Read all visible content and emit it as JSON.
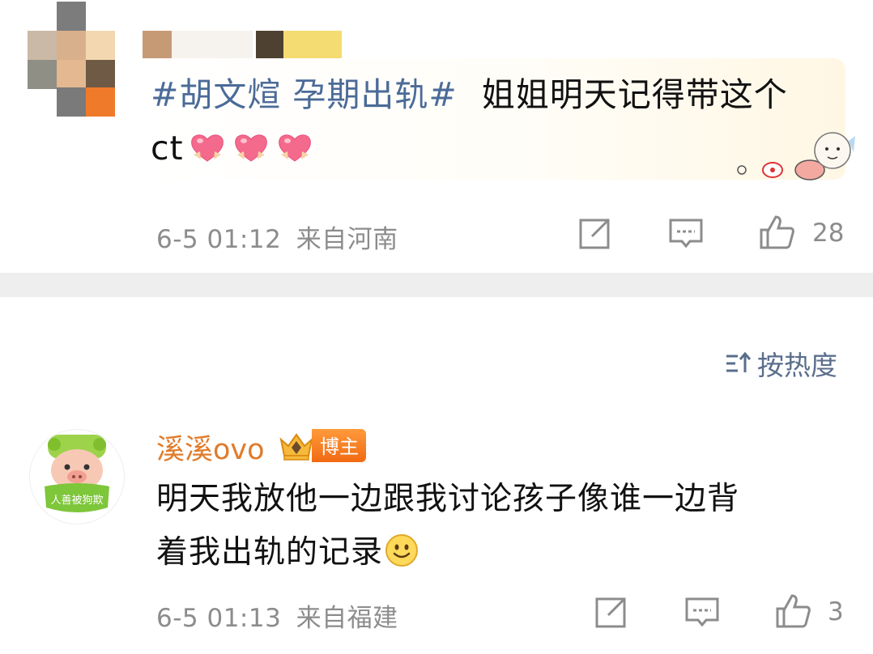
{
  "top_post": {
    "hashtag": "#胡文煊 孕期出轨#",
    "text": "姐姐明天记得带这个",
    "text_line2": "ct",
    "emoji_icons": [
      "pink-heart-emoji",
      "pink-heart-emoji",
      "pink-heart-emoji"
    ],
    "timestamp": "6-5 01:12",
    "location": "来自河南",
    "like_count": "28"
  },
  "sort": {
    "label": "按热度",
    "icon": "sort-icon"
  },
  "comment": {
    "username": "溪溪ovo",
    "badge_label": "博主",
    "avatar_text": "人善被狗欺",
    "text_line1": "明天我放他一边跟我讨论孩子像谁一边背",
    "text_line2": "着我出轨的记录",
    "emoji_icon": "smiley-emoji",
    "timestamp": "6-5 01:13",
    "location": "来自福建",
    "like_count": "3"
  },
  "colors": {
    "hashtag": "#4b6b98",
    "username": "#e07b2a",
    "meta": "#8c8c8c",
    "badge": "#f16a12",
    "divider": "#eeeeee"
  }
}
